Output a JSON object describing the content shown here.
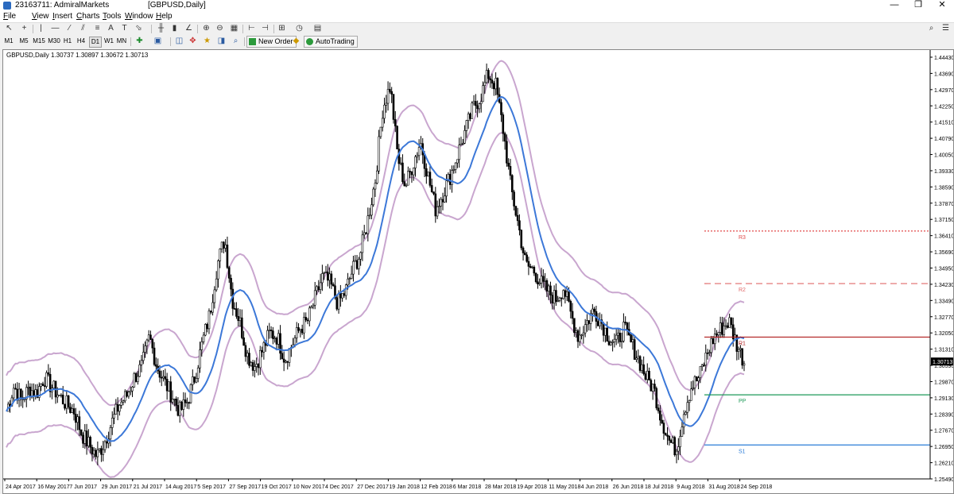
{
  "window": {
    "title": "23163711: AdmiralMarkets",
    "subtitle": "[GBPUSD,Daily]",
    "minimize": "—",
    "restore": "❐",
    "close": "✕"
  },
  "menu": [
    "File",
    "View",
    "Insert",
    "Charts",
    "Tools",
    "Window",
    "Help"
  ],
  "timeframes": [
    "M1",
    "M5",
    "M15",
    "M30",
    "H1",
    "H4",
    "D1",
    "W1",
    "MN"
  ],
  "toolbar": {
    "new_order": "New Order",
    "autotrading": "AutoTrading"
  },
  "chart": {
    "symbol_info": "GBPUSD,Daily  1.30737 1.30897 1.30672 1.30713",
    "current_price": "1.30713",
    "price_ticks": [
      "1.44430",
      "1.43690",
      "1.42970",
      "1.42250",
      "1.41510",
      "1.40790",
      "1.40050",
      "1.39330",
      "1.38590",
      "1.37870",
      "1.37150",
      "1.36410",
      "1.35690",
      "1.34950",
      "1.34230",
      "1.33490",
      "1.32770",
      "1.32050",
      "1.31310",
      "1.30590",
      "1.29870",
      "1.29130",
      "1.28390",
      "1.27670",
      "1.26950",
      "1.26210",
      "1.25490"
    ],
    "date_ticks": [
      "24 Apr 2017",
      "16 May 2017",
      "7 Jun 2017",
      "29 Jun 2017",
      "21 Jul 2017",
      "14 Aug 2017",
      "5 Sep 2017",
      "27 Sep 2017",
      "19 Oct 2017",
      "10 Nov 2017",
      "4 Dec 2017",
      "27 Dec 2017",
      "19 Jan 2018",
      "12 Feb 2018",
      "6 Mar 2018",
      "28 Mar 2018",
      "19 Apr 2018",
      "11 May 2018",
      "4 Jun 2018",
      "26 Jun 2018",
      "18 Jul 2018",
      "9 Aug 2018",
      "31 Aug 2018",
      "24 Sep 2018"
    ],
    "levels": [
      {
        "label": "R3",
        "price": 1.3652,
        "color": "#e04a4a",
        "style": "dotted"
      },
      {
        "label": "R2",
        "price": 1.3418,
        "color": "#e06a6a",
        "style": "dashed"
      },
      {
        "label": "R1",
        "price": 1.318,
        "color": "#b01c1c",
        "style": "solid"
      },
      {
        "label": "PP",
        "price": 1.2923,
        "color": "#1e9a58",
        "style": "solid"
      },
      {
        "label": "S1",
        "price": 1.27,
        "color": "#2a7bd6",
        "style": "solid"
      }
    ],
    "colors": {
      "ma": "#3c78d8",
      "band": "#c9a6cf",
      "candle": "#000000"
    }
  },
  "chart_data": {
    "type": "line",
    "title": "GBPUSD,Daily",
    "series": [
      {
        "name": "GBPUSD",
        "values": [
          1.285,
          1.296,
          1.29,
          1.295,
          1.293,
          1.3,
          1.296,
          1.292,
          1.288,
          1.285,
          1.275,
          1.27,
          1.265,
          1.271,
          1.28,
          1.288,
          1.292,
          1.3,
          1.305,
          1.318,
          1.305,
          1.298,
          1.292,
          1.285,
          1.289,
          1.3,
          1.315,
          1.328,
          1.35,
          1.362,
          1.335,
          1.325,
          1.31,
          1.305,
          1.312,
          1.32,
          1.318,
          1.308,
          1.315,
          1.322,
          1.325,
          1.335,
          1.345,
          1.342,
          1.333,
          1.338,
          1.348,
          1.355,
          1.37,
          1.388,
          1.42,
          1.43,
          1.398,
          1.385,
          1.395,
          1.405,
          1.39,
          1.375,
          1.382,
          1.39,
          1.4,
          1.41,
          1.42,
          1.425,
          1.435,
          1.43,
          1.41,
          1.385,
          1.368,
          1.35,
          1.348,
          1.342,
          1.338,
          1.335,
          1.34,
          1.328,
          1.318,
          1.324,
          1.33,
          1.325,
          1.318,
          1.315,
          1.322,
          1.315,
          1.308,
          1.3,
          1.295,
          1.282,
          1.272,
          1.268,
          1.285,
          1.296,
          1.3,
          1.31,
          1.318,
          1.322,
          1.325,
          1.315,
          1.307
        ]
      }
    ],
    "ylim": [
      1.2549,
      1.4443
    ],
    "ylabel": "",
    "xlabel": ""
  }
}
